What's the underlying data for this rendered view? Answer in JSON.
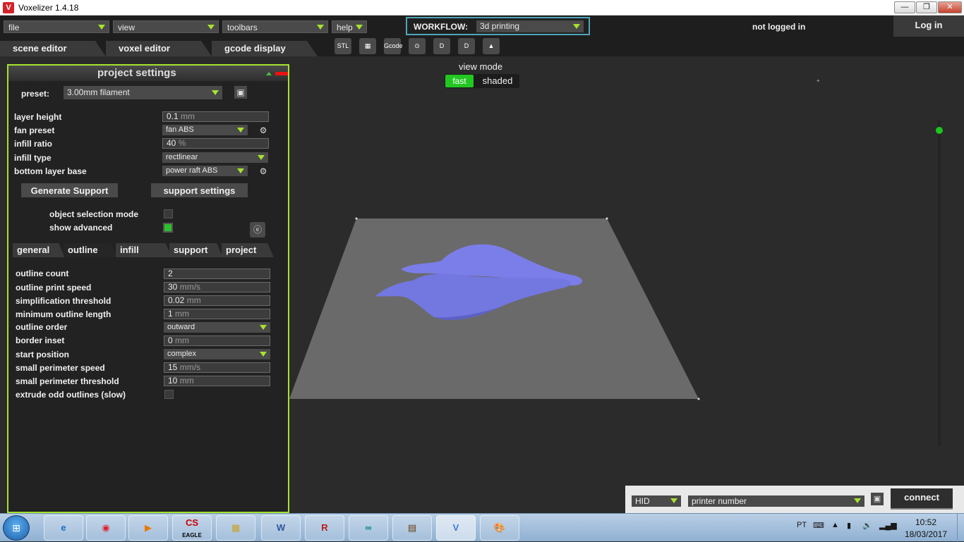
{
  "window": {
    "title": "Voxelizer 1.4.18",
    "minimize": "—",
    "restore": "❐",
    "close": "✕"
  },
  "menu": {
    "file": "file",
    "view": "view",
    "toolbars": "toolbars",
    "help": "help",
    "workflow_label": "WORKFLOW:",
    "workflow_value": "3d printing",
    "login_status": "not logged in",
    "login_button": "Log in"
  },
  "tabs": {
    "scene_editor": "scene editor",
    "voxel_editor": "voxel editor",
    "gcode_display": "gcode display"
  },
  "toolbar": {
    "stl": "STL",
    "gcode": "Gcode",
    "d1": "D",
    "d2": "D"
  },
  "project_settings": {
    "title": "project settings",
    "preset_label": "preset:",
    "preset_value": "3.00mm filament",
    "layer_height_label": "layer height",
    "layer_height_value": "0.1",
    "layer_height_unit": "mm",
    "fan_preset_label": "fan preset",
    "fan_preset_value": "fan ABS",
    "infill_ratio_label": "infill ratio",
    "infill_ratio_value": "40",
    "infill_ratio_unit": "%",
    "infill_type_label": "infill type",
    "infill_type_value": "rectlinear",
    "bottom_layer_label": "bottom layer base",
    "bottom_layer_value": "power raft ABS",
    "generate_support": "Generate Support",
    "support_settings": "support settings",
    "object_selection_label": "object selection mode",
    "show_advanced_label": "show advanced",
    "subtabs": {
      "general": "general",
      "outline": "outline",
      "infill": "infill",
      "support": "support",
      "project": "project"
    },
    "outline_count_label": "outline count",
    "outline_count_value": "2",
    "outline_speed_label": "outline print speed",
    "outline_speed_value": "30",
    "outline_speed_unit": "mm/s",
    "simplification_label": "simplification threshold",
    "simplification_value": "0.02",
    "simplification_unit": "mm",
    "min_outline_label": "minimum outline length",
    "min_outline_value": "1",
    "min_outline_unit": "mm",
    "outline_order_label": "outline order",
    "outline_order_value": "outward",
    "border_inset_label": "border inset",
    "border_inset_value": "0",
    "border_inset_unit": "mm",
    "start_position_label": "start position",
    "start_position_value": "complex",
    "small_perim_speed_label": "small perimeter speed",
    "small_perim_speed_value": "15",
    "small_perim_speed_unit": "mm/s",
    "small_perim_thresh_label": "small perimeter threshold",
    "small_perim_thresh_value": "10",
    "small_perim_thresh_unit": "mm",
    "extrude_odd_label": "extrude odd outlines (slow)"
  },
  "viewport": {
    "view_mode_label": "view mode",
    "fast": "fast",
    "shaded": "shaded"
  },
  "connection": {
    "protocol": "HID",
    "printer": "printer number",
    "connect": "connect"
  },
  "taskbar": {
    "apps": [
      "e",
      "◉",
      "▶",
      "CS",
      "▦",
      "W",
      "R",
      "∞",
      "▤",
      "V",
      "🎨"
    ],
    "eagle_label": "EAGLE",
    "lang": "PT",
    "time": "10:52",
    "date": "18/03/2017"
  },
  "colors": {
    "accent_green": "#a6e22e",
    "model": "#7b7ee8",
    "bed": "#6a6a6a"
  }
}
